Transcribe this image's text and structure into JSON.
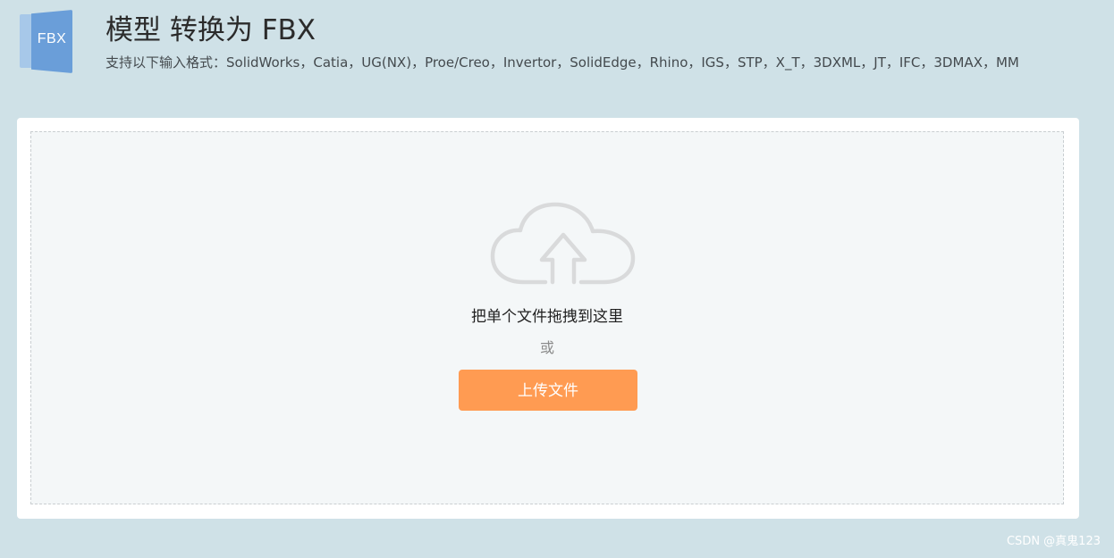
{
  "header": {
    "logo_text": "FBX",
    "title": "模型 转换为 FBX",
    "subtitle": "支持以下输入格式：SolidWorks，Catia，UG(NX)，Proe/Creo，Invertor，SolidEdge，Rhino，IGS，STP，X_T，3DXML，JT，IFC，3DMAX，MM"
  },
  "upload": {
    "icon": "cloud-upload-icon",
    "drop_text": "把单个文件拖拽到这里",
    "or_text": "或",
    "button_label": "上传文件"
  },
  "watermark": "CSDN @真鬼123",
  "colors": {
    "background": "#cfe1e7",
    "button": "#ff9b52",
    "logo_front": "#6a9ed9",
    "logo_back": "#a7c8e9",
    "icon_stroke": "#d9dadb"
  }
}
